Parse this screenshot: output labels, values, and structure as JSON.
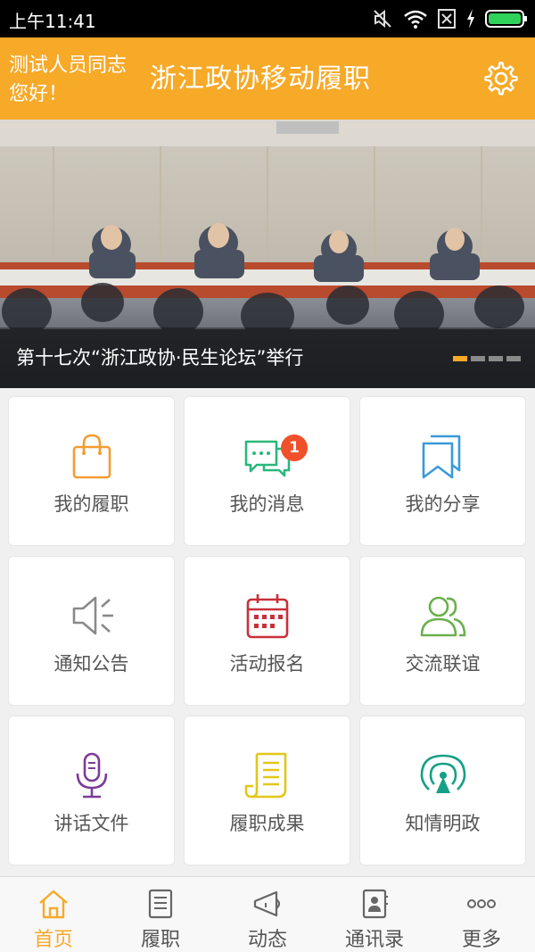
{
  "status_bar": {
    "time": "上午11:41",
    "icons": [
      "silent-vibrate-icon",
      "wifi-icon",
      "sim-off-icon",
      "charging-icon",
      "battery-icon"
    ]
  },
  "header": {
    "greeting_line1": "测试人员同志",
    "greeting_line2": "您好！",
    "title": "浙江政协移动履职",
    "settings_icon": "gear-icon",
    "bg_color": "#f7a928"
  },
  "banner": {
    "caption": "第十七次“浙江政协·民生论坛”举行",
    "slide_count": 4,
    "active_slide": 1
  },
  "grid": {
    "items": [
      {
        "label": "我的履职",
        "icon": "shopping-bag-icon",
        "color": "#f39c32"
      },
      {
        "label": "我的消息",
        "icon": "chat-bubbles-icon",
        "color": "#2ab77a",
        "badge": "1"
      },
      {
        "label": "我的分享",
        "icon": "bookmark-share-icon",
        "color": "#3a9ad9"
      },
      {
        "label": "通知公告",
        "icon": "megaphone-icon",
        "color": "#8a8a8a"
      },
      {
        "label": "活动报名",
        "icon": "calendar-icon",
        "color": "#c8303a"
      },
      {
        "label": "交流联谊",
        "icon": "users-icon",
        "color": "#6ab04c"
      },
      {
        "label": "讲话文件",
        "icon": "microphone-icon",
        "color": "#7d3c98"
      },
      {
        "label": "履职成果",
        "icon": "document-list-icon",
        "color": "#e3c619"
      },
      {
        "label": "知情明政",
        "icon": "broadcast-icon",
        "color": "#16a085"
      }
    ]
  },
  "tabbar": {
    "items": [
      {
        "label": "首页",
        "icon": "home-icon",
        "active": true
      },
      {
        "label": "履职",
        "icon": "document-icon",
        "active": false
      },
      {
        "label": "动态",
        "icon": "megaphone-icon",
        "active": false
      },
      {
        "label": "通讯录",
        "icon": "contacts-icon",
        "active": false
      },
      {
        "label": "更多",
        "icon": "more-icon",
        "active": false
      }
    ],
    "active_color": "#f7a928"
  }
}
